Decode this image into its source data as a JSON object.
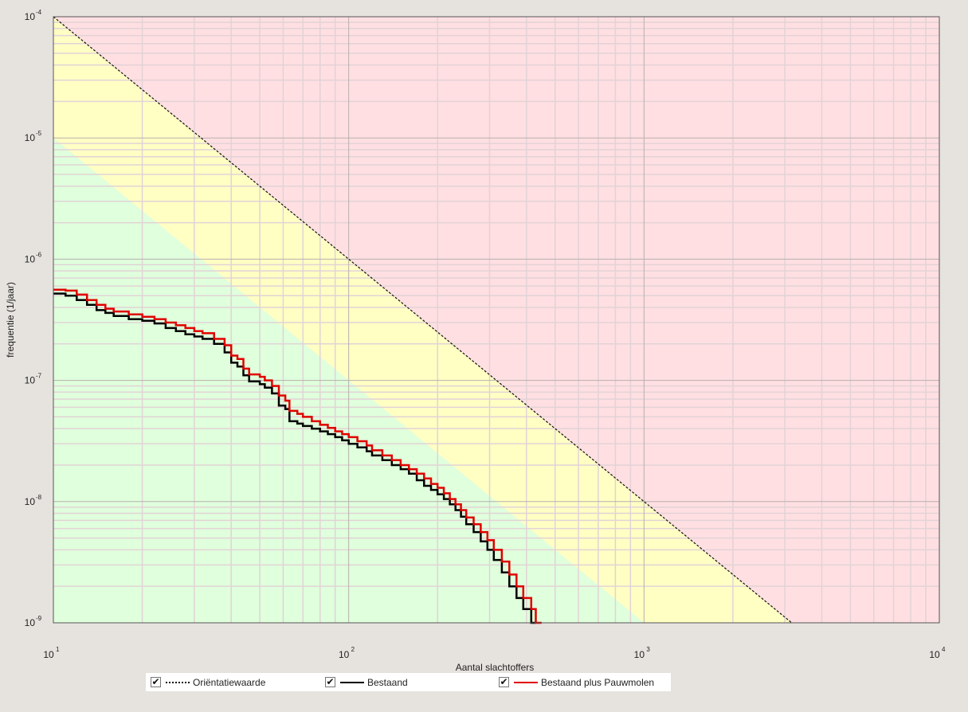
{
  "chart_data": {
    "type": "line",
    "title": "",
    "xlabel": "Aantal slachtoffers",
    "ylabel": "frequentie (1/jaar)",
    "xscale": "log",
    "yscale": "log",
    "xlim": [
      10,
      10000
    ],
    "ylim": [
      1e-09,
      0.0001
    ],
    "x_ticks": [
      {
        "base": "10",
        "exp": "1"
      },
      {
        "base": "10",
        "exp": "2"
      },
      {
        "base": "10",
        "exp": "3"
      },
      {
        "base": "10",
        "exp": "4"
      }
    ],
    "y_ticks": [
      {
        "base": "10",
        "exp": "-4"
      },
      {
        "base": "10",
        "exp": "-5"
      },
      {
        "base": "10",
        "exp": "-6"
      },
      {
        "base": "10",
        "exp": "-7"
      },
      {
        "base": "10",
        "exp": "-8"
      },
      {
        "base": "10",
        "exp": "-9"
      }
    ],
    "grid": true,
    "legend_position": "bottom",
    "zones": {
      "red": "#ffdfe2",
      "yellow": "#ffffc4",
      "green": "#dfffdd"
    },
    "series": [
      {
        "name": "Oriëntatiewaarde",
        "style": "dotted",
        "color": "#111111",
        "x": [
          10,
          3162
        ],
        "y": [
          0.0001,
          1e-09
        ]
      },
      {
        "name": "Bestaand",
        "style": "step",
        "color": "#000000",
        "x": [
          10,
          11,
          12,
          13,
          14,
          15,
          16,
          18,
          20,
          22,
          24,
          26,
          28,
          30,
          32,
          35,
          38,
          40,
          42,
          44,
          46,
          50,
          52,
          55,
          58,
          61,
          63,
          67,
          70,
          75,
          80,
          85,
          90,
          95,
          100,
          107,
          115,
          120,
          130,
          140,
          150,
          160,
          170,
          180,
          190,
          200,
          210,
          220,
          230,
          240,
          250,
          265,
          280,
          295,
          310,
          330,
          350,
          370,
          390,
          415,
          430,
          450,
          470,
          480,
          490,
          510,
          540
        ],
        "y": [
          5.2e-07,
          5e-07,
          4.6e-07,
          4.2e-07,
          3.8e-07,
          3.6e-07,
          3.4e-07,
          3.2e-07,
          3.1e-07,
          2.95e-07,
          2.7e-07,
          2.55e-07,
          2.4e-07,
          2.3e-07,
          2.2e-07,
          2e-07,
          1.7e-07,
          1.4e-07,
          1.3e-07,
          1.1e-07,
          9.8e-08,
          9.3e-08,
          8.7e-08,
          7.8e-08,
          6.2e-08,
          5.8e-08,
          4.6e-08,
          4.4e-08,
          4.2e-08,
          4e-08,
          3.8e-08,
          3.6e-08,
          3.4e-08,
          3.2e-08,
          3e-08,
          2.8e-08,
          2.6e-08,
          2.4e-08,
          2.2e-08,
          2e-08,
          1.85e-08,
          1.7e-08,
          1.5e-08,
          1.35e-08,
          1.25e-08,
          1.15e-08,
          1.05e-08,
          9.5e-09,
          8.5e-09,
          7.5e-09,
          6.5e-09,
          5.6e-09,
          4.7e-09,
          4e-09,
          3.3e-09,
          2.6e-09,
          2e-09,
          1.6e-09,
          1.3e-09,
          1e-09,
          null,
          null,
          null,
          null,
          null,
          null,
          null
        ]
      },
      {
        "name": "Bestaand plus Pauwmolen",
        "style": "step",
        "color": "#e00000",
        "x": [
          10,
          11,
          12,
          13,
          14,
          15,
          16,
          18,
          20,
          22,
          24,
          26,
          28,
          30,
          32,
          35,
          38,
          40,
          42,
          44,
          46,
          50,
          52,
          55,
          58,
          61,
          63,
          67,
          70,
          75,
          80,
          85,
          90,
          95,
          100,
          107,
          115,
          120,
          130,
          140,
          150,
          160,
          170,
          180,
          190,
          200,
          210,
          220,
          230,
          240,
          250,
          265,
          280,
          295,
          310,
          330,
          350,
          370,
          390,
          415,
          430,
          450,
          470,
          480,
          490,
          510,
          540
        ],
        "y": [
          5.6e-07,
          5.5e-07,
          5.1e-07,
          4.6e-07,
          4.2e-07,
          3.9e-07,
          3.7e-07,
          3.5e-07,
          3.35e-07,
          3.2e-07,
          3e-07,
          2.85e-07,
          2.7e-07,
          2.55e-07,
          2.45e-07,
          2.2e-07,
          1.95e-07,
          1.6e-07,
          1.5e-07,
          1.25e-07,
          1.12e-07,
          1.07e-07,
          1e-07,
          9e-08,
          7.5e-08,
          6.8e-08,
          5.6e-08,
          5.3e-08,
          5e-08,
          4.6e-08,
          4.3e-08,
          4.05e-08,
          3.8e-08,
          3.6e-08,
          3.4e-08,
          3.15e-08,
          2.9e-08,
          2.65e-08,
          2.4e-08,
          2.2e-08,
          2e-08,
          1.85e-08,
          1.7e-08,
          1.55e-08,
          1.4e-08,
          1.3e-08,
          1.17e-08,
          1.05e-08,
          9.5e-09,
          8.5e-09,
          7.4e-09,
          6.5e-09,
          5.6e-09,
          4.8e-09,
          4e-09,
          3.2e-09,
          2.5e-09,
          2e-09,
          1.6e-09,
          1.3e-09,
          1e-09,
          null,
          null,
          null,
          null,
          null,
          null
        ]
      }
    ]
  },
  "legend": {
    "items": [
      {
        "check": "✔",
        "label": "Oriëntatiewaarde"
      },
      {
        "check": "✔",
        "label": "Bestaand"
      },
      {
        "check": "✔",
        "label": "Bestaand plus Pauwmolen"
      }
    ]
  }
}
